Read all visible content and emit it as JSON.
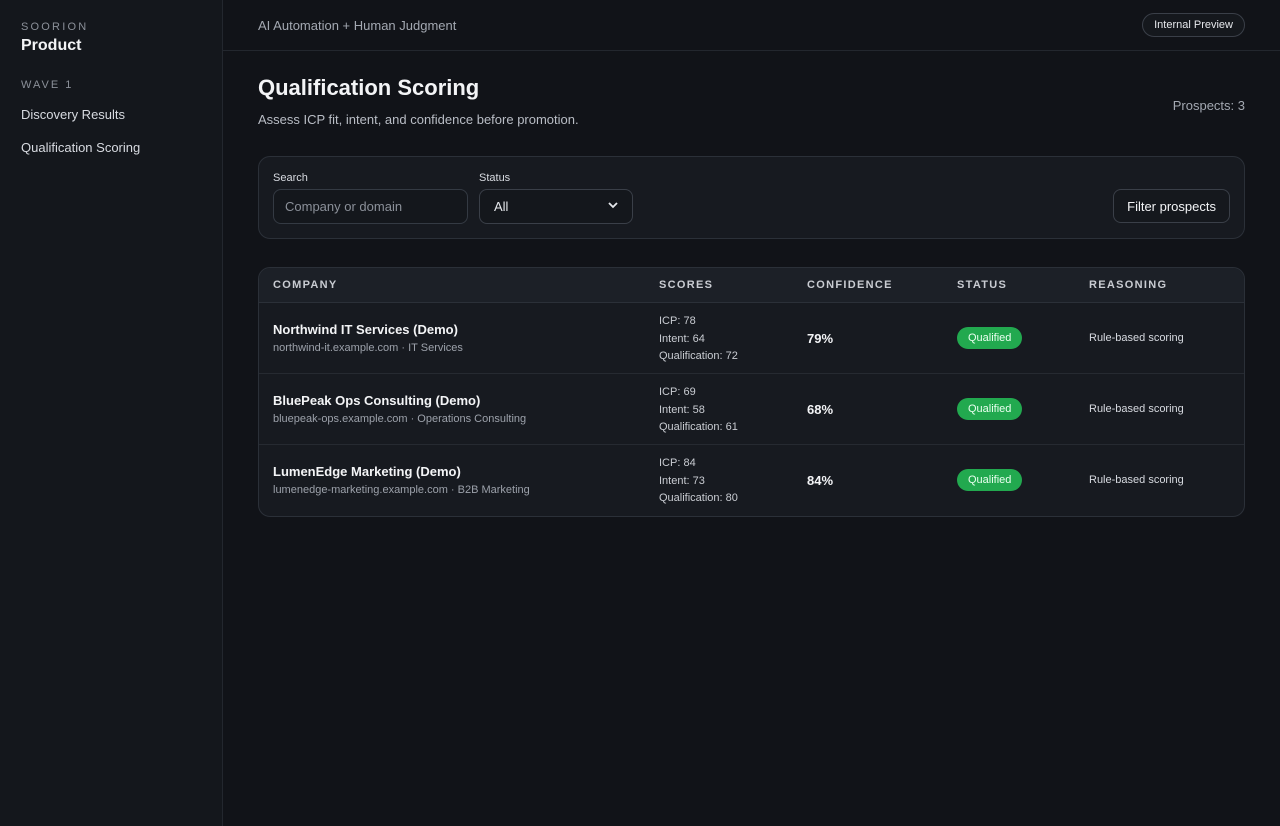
{
  "sidebar": {
    "kicker": "SOORION",
    "title": "Product",
    "section": "WAVE 1",
    "items": [
      {
        "label": "Discovery Results"
      },
      {
        "label": "Qualification Scoring"
      }
    ]
  },
  "topbar": {
    "title": "AI Automation + Human Judgment",
    "pill": "Internal Preview"
  },
  "page": {
    "title": "Qualification Scoring",
    "subtitle": "Assess ICP fit, intent, and confidence before promotion.",
    "prospect_count": "Prospects: 3"
  },
  "filters": {
    "search_label": "Search",
    "search_placeholder": "Company or domain",
    "search_value": "",
    "status_label": "Status",
    "status_value": "All",
    "button_label": "Filter prospects"
  },
  "table": {
    "headers": [
      "COMPANY",
      "SCORES",
      "CONFIDENCE",
      "STATUS",
      "REASONING"
    ],
    "rows": [
      {
        "company": "Northwind IT Services (Demo)",
        "meta": "northwind-it.example.com · IT Services",
        "icp": "ICP: 78",
        "intent": "Intent: 64",
        "qualification": "Qualification: 72",
        "confidence": "79%",
        "status": "Qualified",
        "reasoning": "Rule-based scoring"
      },
      {
        "company": "BluePeak Ops Consulting (Demo)",
        "meta": "bluepeak-ops.example.com · Operations Consulting",
        "icp": "ICP: 69",
        "intent": "Intent: 58",
        "qualification": "Qualification: 61",
        "confidence": "68%",
        "status": "Qualified",
        "reasoning": "Rule-based scoring"
      },
      {
        "company": "LumenEdge Marketing (Demo)",
        "meta": "lumenedge-marketing.example.com · B2B Marketing",
        "icp": "ICP: 84",
        "intent": "Intent: 73",
        "qualification": "Qualification: 80",
        "confidence": "84%",
        "status": "Qualified",
        "reasoning": "Rule-based scoring"
      }
    ]
  },
  "icons": {
    "status_select_chevron": "chevron-down-icon"
  },
  "colors": {
    "background": "#111318",
    "sidebar": "#14171c",
    "qualified_badge": "#22a94f"
  }
}
